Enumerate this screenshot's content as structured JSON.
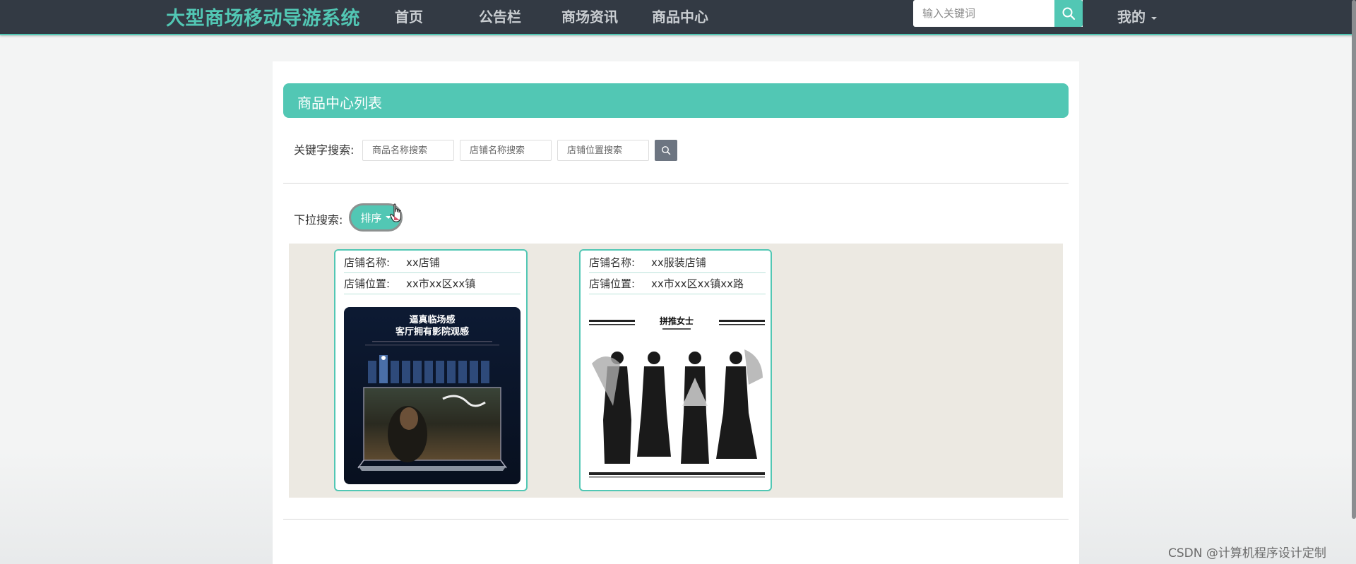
{
  "nav": {
    "brand": "大型商场移动导游系统",
    "items": [
      {
        "label": "首页"
      },
      {
        "label": "公告栏"
      },
      {
        "label": "商场资讯"
      },
      {
        "label": "商品中心"
      }
    ],
    "search_placeholder": "输入关键词",
    "mine_label": "我的"
  },
  "page": {
    "title": "商品中心列表",
    "keyword_label": "关键字搜索:",
    "filters": [
      {
        "placeholder": "商品名称搜索"
      },
      {
        "placeholder": "店铺名称搜索"
      },
      {
        "placeholder": "店铺位置搜索"
      }
    ],
    "dropdown_label": "下拉搜索:",
    "sort_label": "排序"
  },
  "products": [
    {
      "shop_name_label": "店铺名称:",
      "shop_name": "xx店铺",
      "shop_location_label": "店铺位置:",
      "shop_location": "xx市xx区xx镇",
      "image": {
        "headline1": "逼真临场感",
        "headline2": "客厅拥有影院观感"
      }
    },
    {
      "shop_name_label": "店铺名称:",
      "shop_name": "xx服装店铺",
      "shop_location_label": "店铺位置:",
      "shop_location": "xx市xx区xx镇xx路",
      "image": {
        "brand": "拼推女士"
      }
    }
  ],
  "watermark": "CSDN @计算机程序设计定制",
  "colors": {
    "accent": "#52c7b4",
    "navbar": "#333a44",
    "product_area": "#ece9e2"
  }
}
